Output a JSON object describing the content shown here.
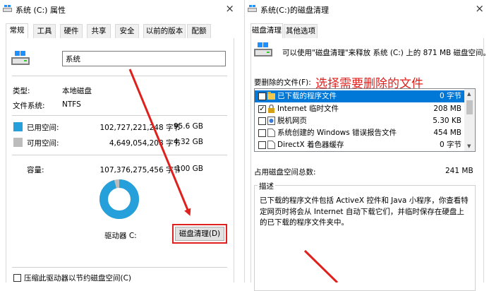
{
  "left_window": {
    "title": "系统 (C:) 属性",
    "close_glyph": "×",
    "tabs": [
      "常规",
      "工具",
      "硬件",
      "共享",
      "安全",
      "以前的版本",
      "配额"
    ],
    "active_tab": "常规",
    "drive_name": "系统",
    "type_label": "类型:",
    "type_value": "本地磁盘",
    "fs_label": "文件系统:",
    "fs_value": "NTFS",
    "used_label": "已用空间:",
    "used_bytes": "102,727,221,248 字节",
    "used_size": "95.6 GB",
    "free_label": "可用空间:",
    "free_bytes": "4,649,054,208 字节",
    "free_size": "4.32 GB",
    "capacity_label": "容量:",
    "capacity_bytes": "107,376,275,456 字节",
    "capacity_size": "100 GB",
    "drive_label": "驱动器 C:",
    "cleanup_button": "磁盘清理(D)",
    "compress_label": "压缩此驱动器以节约磁盘空间(C)",
    "used_fraction": 0.957,
    "colors": {
      "used": "#26a0da",
      "free": "#bcbcbc"
    }
  },
  "right_window": {
    "title": "系统(C:)的磁盘清理",
    "close_glyph": "×",
    "tabs": [
      "磁盘清理",
      "其他选项"
    ],
    "active_tab": "磁盘清理",
    "intro": "可以使用\"磁盘清理\"来释放 系统 (C:) 上的 871 MB 磁盘空间。",
    "files_label": "要删除的文件(F):",
    "files": [
      {
        "name": "已下载的程序文件",
        "size": "0 字节",
        "checked": true,
        "selected": true,
        "icon": "folder-icon"
      },
      {
        "name": "Internet 临时文件",
        "size": "208 MB",
        "checked": true,
        "selected": false,
        "icon": "lock-icon"
      },
      {
        "name": "脱机网页",
        "size": "5.30 KB",
        "checked": false,
        "selected": false,
        "icon": "offline-page-icon"
      },
      {
        "name": "系统创建的 Windows 错误报告文件",
        "size": "454 MB",
        "checked": false,
        "selected": false,
        "icon": "file-icon"
      },
      {
        "name": "DirectX 着色器缓存",
        "size": "0 字节",
        "checked": false,
        "selected": false,
        "icon": "file-icon"
      }
    ],
    "total_label": "占用磁盘空间总数:",
    "total_value": "241 MB",
    "desc_title": "描述",
    "description": "已下载的程序文件包括 ActiveX 控件和 Java 小程序，你查看特定网页时将会从 Internet 自动下载它们，并临时保存在硬盘上的已下载的程序文件夹中。"
  },
  "annotation": {
    "text": "选择需要删除的文件",
    "color": "#e0201c"
  }
}
